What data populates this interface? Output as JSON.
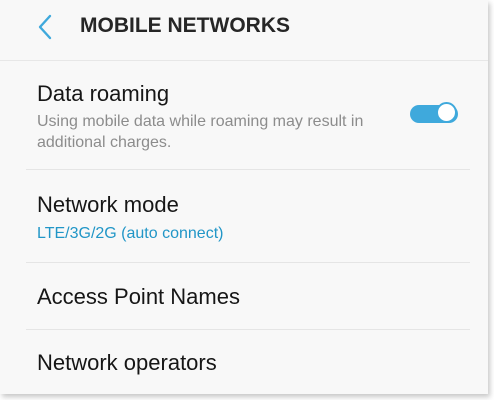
{
  "header": {
    "title": "MOBILE NETWORKS",
    "back_icon": "chevron-left-icon"
  },
  "colors": {
    "accent": "#3fa9dc",
    "title_text": "#161616",
    "secondary_text": "#8c8c8c",
    "link_text": "#2196c7",
    "background": "#f8f8f8"
  },
  "settings": {
    "data_roaming": {
      "title": "Data roaming",
      "description": "Using mobile data while roaming may result in additional charges.",
      "enabled": true
    },
    "network_mode": {
      "title": "Network mode",
      "value": "LTE/3G/2G (auto connect)"
    },
    "access_point_names": {
      "title": "Access Point Names"
    },
    "network_operators": {
      "title": "Network operators"
    }
  }
}
